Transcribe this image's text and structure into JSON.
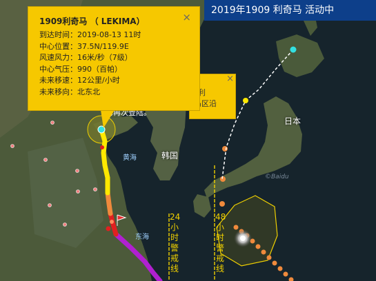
{
  "status_bar": {
    "text": "2019年1909 利奇马 活动中"
  },
  "typhoon_popup": {
    "title": "1909利奇马 （ LEKIMA）",
    "close_label": "×",
    "rows": [
      "到达时间：2019-08-13 11时",
      "中心位置：37.5N/119.9E",
      "风速风力：16米/秒（7级）",
      "中心气压：990（百帕）",
      "未来移速：12公里/小时",
      "未来移向：北东北"
    ]
  },
  "partial_popup": {
    "close_label": "×",
    "line1": "利",
    "line2": "岛区沿",
    "line3": "海再次登陆。"
  },
  "map_labels": {
    "japan": "日本",
    "korea": "韩国",
    "yellow_sea": "黄海",
    "east_sea": "东海",
    "attribution": "©Baidu"
  },
  "warning_lines": {
    "h24": [
      "24",
      "小",
      "时",
      "警",
      "戒",
      "线"
    ],
    "h48": [
      "48",
      "小",
      "时",
      "警",
      "戒",
      "线"
    ]
  },
  "colors": {
    "status_bg": "#0d3f8a",
    "popup_bg": "#f6c800",
    "track_yellow": "#ffe900",
    "track_orange": "#f08a3c",
    "track_red": "#e02020",
    "track_purple": "#b020d0",
    "forecast_cyan": "#33e0e0",
    "warning_line": "#f0d000",
    "city_dot": "#f08080"
  },
  "icons": {
    "typhoon": "typhoon-icon",
    "close": "close-icon",
    "flag": "red-flag-icon"
  }
}
